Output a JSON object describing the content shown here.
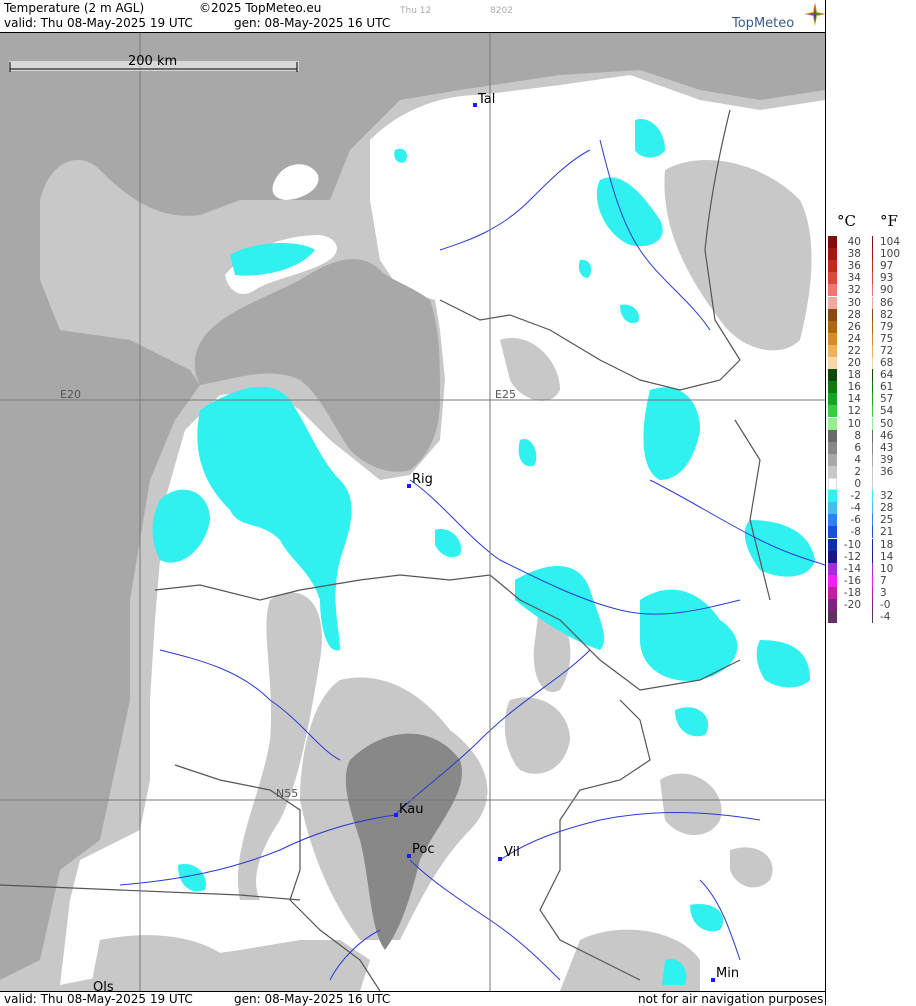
{
  "header": {
    "title": "Temperature (2 m AGL)",
    "copyright": "©2025 TopMeteo.eu",
    "faint_day": "Thu 12",
    "faint_code": "8202",
    "valid": "valid:  Thu  08-May-2025  19 UTC",
    "gen": "gen:  08-May-2025 16 UTC",
    "logo": "TopMeteo"
  },
  "map": {
    "scale_label": "200 km",
    "grid_labels": [
      "E20",
      "E25",
      "N55"
    ],
    "cities": [
      "Tal",
      "Rig",
      "Kau",
      "Poc",
      "Vil",
      "Min",
      "Ols"
    ]
  },
  "footer": {
    "valid": "valid:  Thu  08-May-2025  19 UTC",
    "gen": "gen:  08-May-2025 16 UTC",
    "disclaimer": "not for air navigation purposes"
  },
  "legend": {
    "unit_c": "°C",
    "unit_f": "°F",
    "rows": [
      {
        "c": "40",
        "f": "104",
        "color": "#7a1010"
      },
      {
        "c": "38",
        "f": "100",
        "color": "#a01a10"
      },
      {
        "c": "36",
        "f": "97",
        "color": "#c02a18"
      },
      {
        "c": "34",
        "f": "93",
        "color": "#d84a3a"
      },
      {
        "c": "32",
        "f": "90",
        "color": "#e87a70"
      },
      {
        "c": "30",
        "f": "86",
        "color": "#f0a8a0"
      },
      {
        "c": "28",
        "f": "82",
        "color": "#8a4a10"
      },
      {
        "c": "26",
        "f": "79",
        "color": "#b06418"
      },
      {
        "c": "24",
        "f": "75",
        "color": "#d88a30"
      },
      {
        "c": "22",
        "f": "72",
        "color": "#f0b060"
      },
      {
        "c": "20",
        "f": "68",
        "color": "#f8d8a8"
      },
      {
        "c": "18",
        "f": "64",
        "color": "#0a4a0a"
      },
      {
        "c": "16",
        "f": "61",
        "color": "#107a10"
      },
      {
        "c": "14",
        "f": "57",
        "color": "#20a020"
      },
      {
        "c": "12",
        "f": "54",
        "color": "#40c840"
      },
      {
        "c": "10",
        "f": "50",
        "color": "#90f090"
      },
      {
        "c": "8",
        "f": "46",
        "color": "#6a6a6a"
      },
      {
        "c": "6",
        "f": "43",
        "color": "#888888"
      },
      {
        "c": "4",
        "f": "39",
        "color": "#a8a8a8"
      },
      {
        "c": "2",
        "f": "36",
        "color": "#c8c8c8"
      },
      {
        "c": "0",
        "f": "",
        "color": "#ffffff"
      },
      {
        "c": "-2",
        "f": "32",
        "color": "#30f0f0"
      },
      {
        "c": "-4",
        "f": "28",
        "color": "#50b8f0"
      },
      {
        "c": "-6",
        "f": "25",
        "color": "#3080f0"
      },
      {
        "c": "-8",
        "f": "21",
        "color": "#1850d8"
      },
      {
        "c": "-10",
        "f": "18",
        "color": "#1030a8"
      },
      {
        "c": "-12",
        "f": "14",
        "color": "#1a1a80"
      },
      {
        "c": "-14",
        "f": "10",
        "color": "#a030d0"
      },
      {
        "c": "-16",
        "f": "7",
        "color": "#f020f0"
      },
      {
        "c": "-18",
        "f": "3",
        "color": "#c020a0"
      },
      {
        "c": "-20",
        "f": "-0",
        "color": "#802080"
      },
      {
        "c": "",
        "f": "-4",
        "color": "#603060"
      }
    ]
  }
}
